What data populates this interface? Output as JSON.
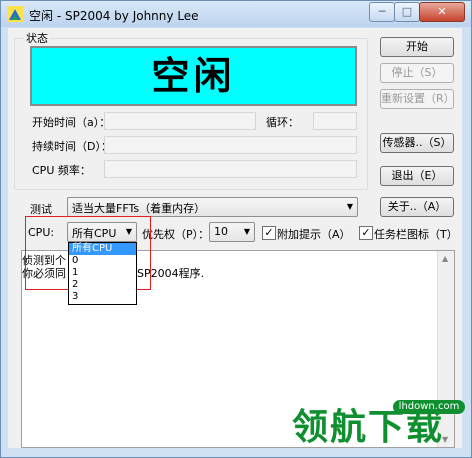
{
  "window": {
    "title": "空闲 - SP2004 by Johnny Lee"
  },
  "controls": {
    "minimize": "─",
    "maximize": "□",
    "close": "✕"
  },
  "status": {
    "group_title": "状态",
    "display": "空闲"
  },
  "fields": {
    "start_time": "开始时间（a）：",
    "loop": "循环：",
    "duration": "持续时间（D）：",
    "cpu_freq": "CPU 频率："
  },
  "buttons": {
    "start": "开始",
    "stop": "停止（S）",
    "reset": "重新设置（R）",
    "sensors": "传感器..（S）",
    "exit": "退出（E）",
    "about": "关于..（A）"
  },
  "test": {
    "label": "测试",
    "selected": "适当大量FFTs（着重内存）"
  },
  "cpu": {
    "label": "CPU:",
    "selected": "所有CPU",
    "options": [
      "所有CPU",
      "0",
      "1",
      "2",
      "3"
    ]
  },
  "priority": {
    "label": "优先权（P）：",
    "value": "10"
  },
  "checkboxes": {
    "extra_hint": "附加提示（A）",
    "taskbar_icon": "任务栏图标（T）"
  },
  "log": {
    "line1": "侦测到个",
    "line2a": "你必须同",
    "line2b": "SP2004程序."
  },
  "watermark": {
    "brand": "领航下载",
    "url": "lhdown.com"
  },
  "colors": {
    "status_bg": "#00ffff",
    "highlight": "#3399ff",
    "annotation": "#e02020",
    "watermark": "#0f8f2f"
  }
}
